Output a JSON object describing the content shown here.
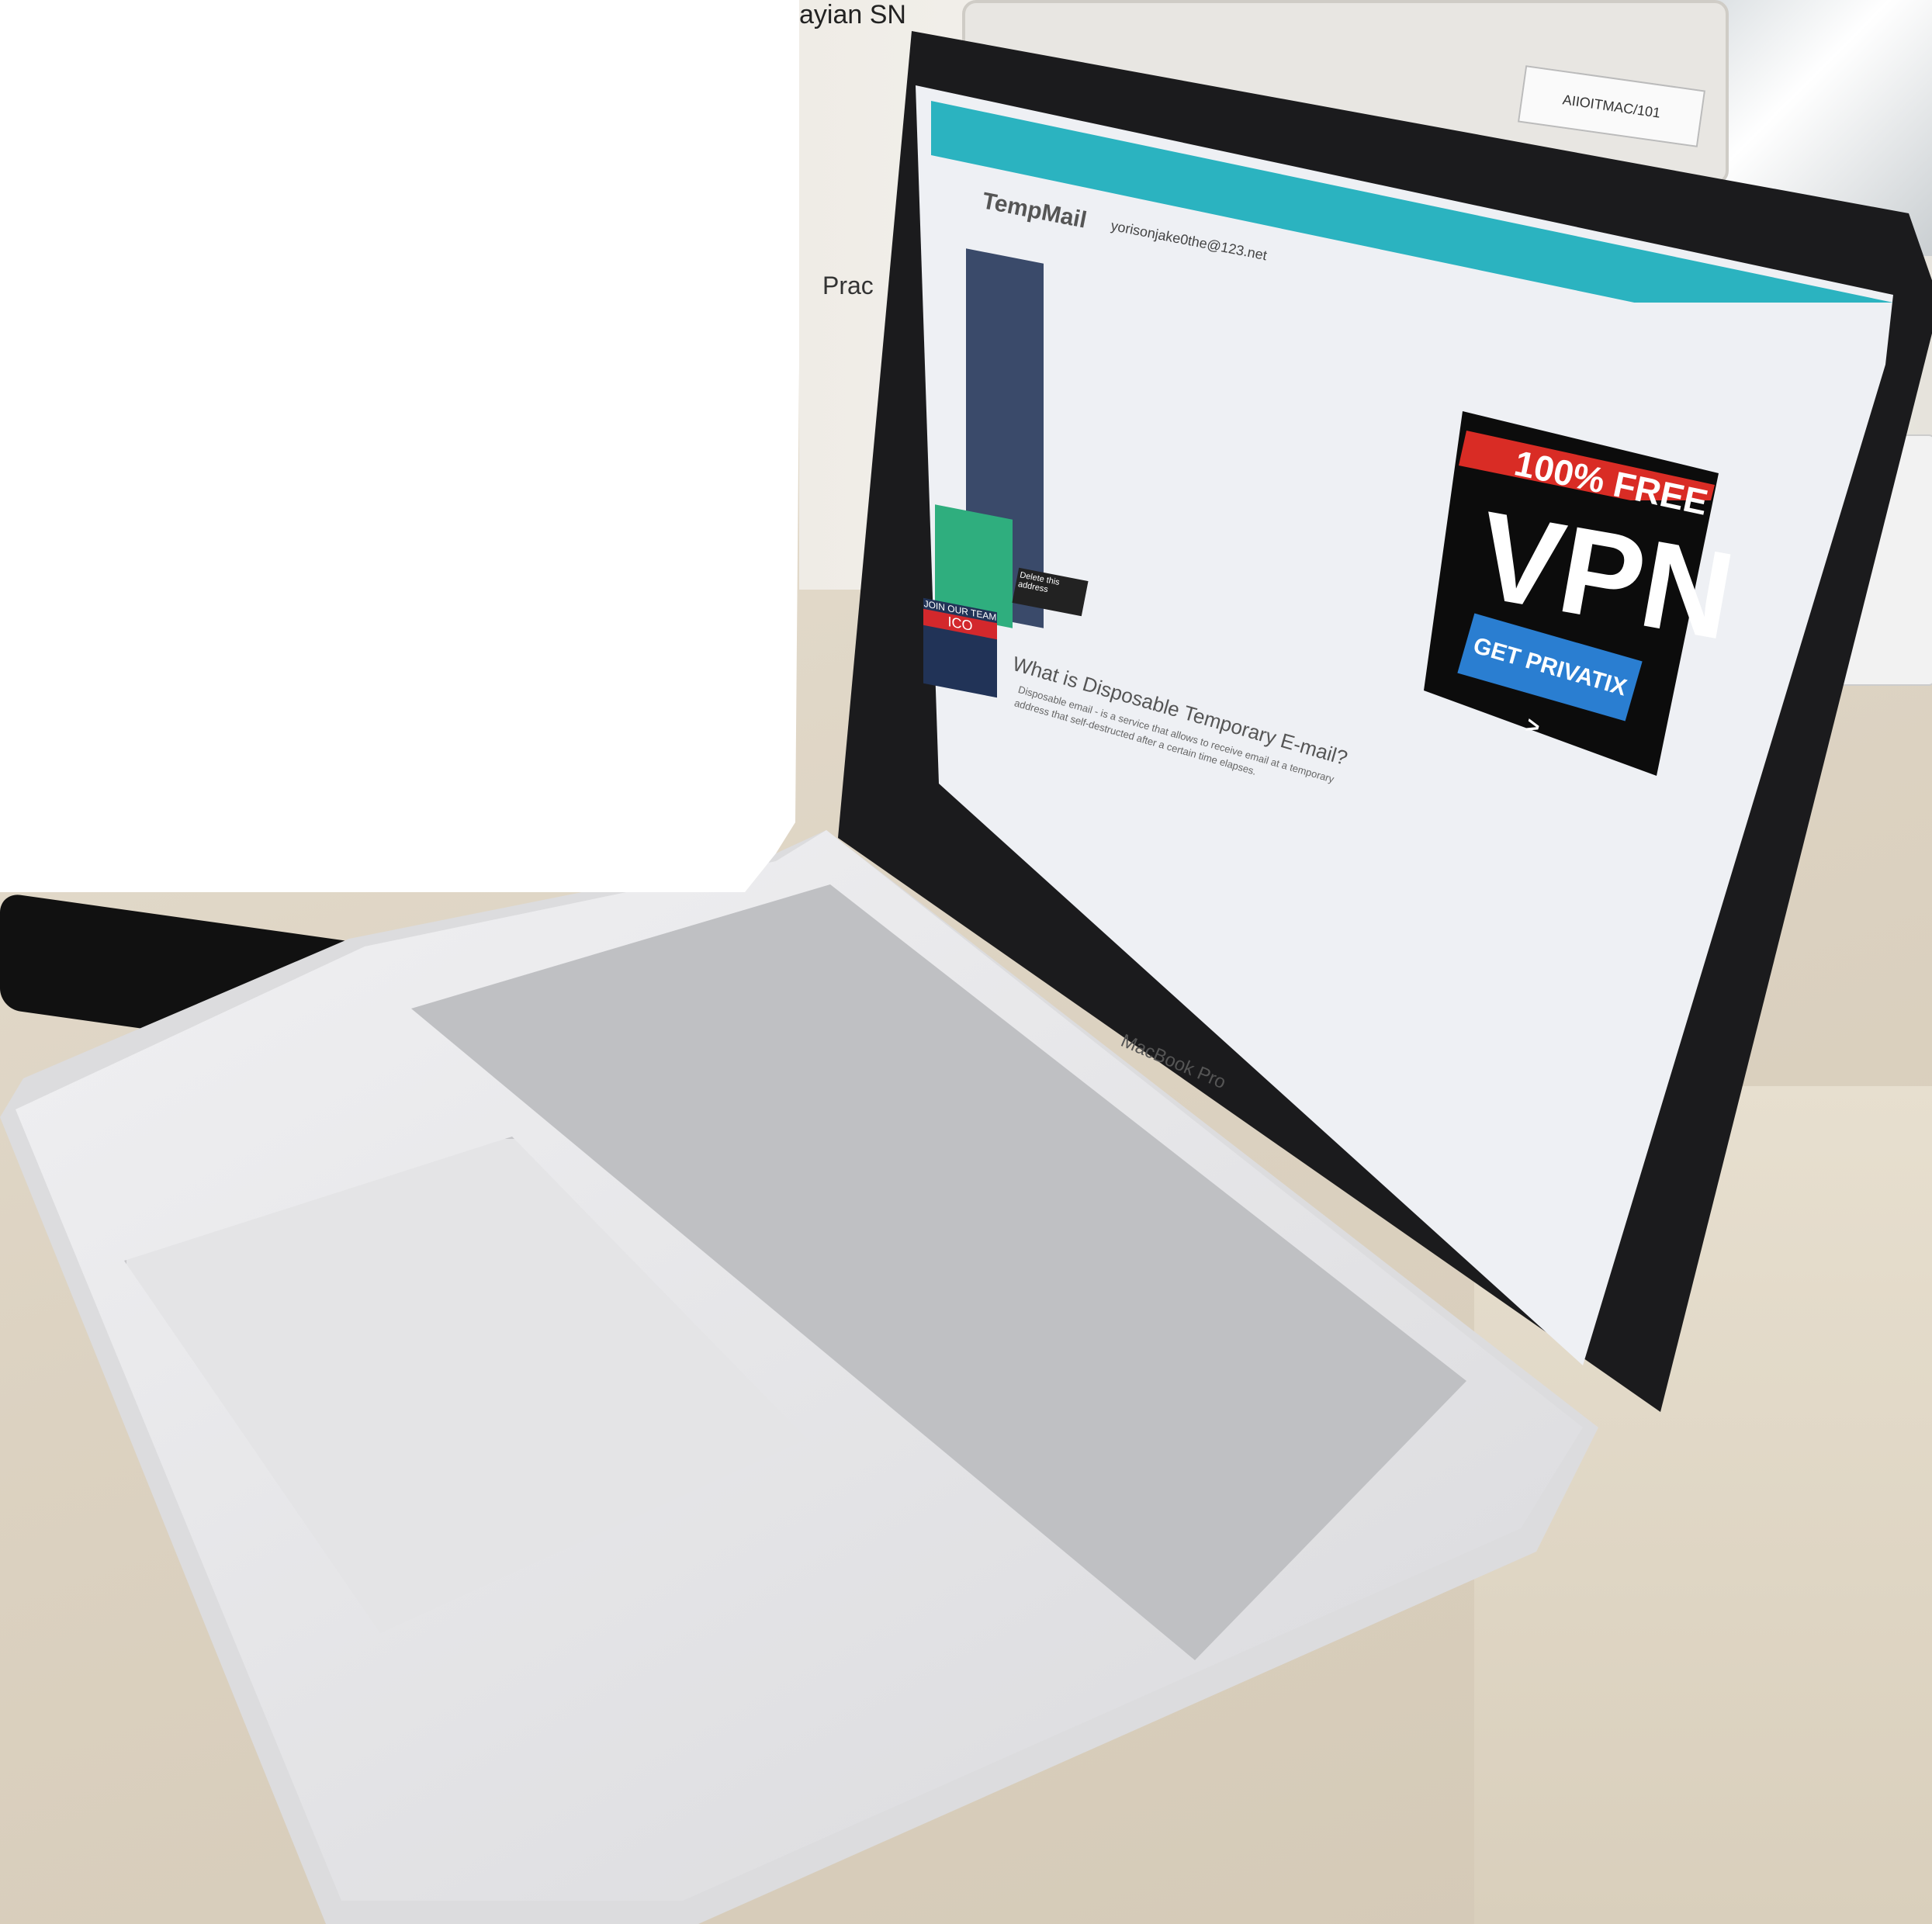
{
  "scene": {
    "desk_color": "#dcd2c1",
    "laptop_color": "#d9d9dc",
    "background_name_sign": "ayian SN",
    "background_sign": "Prac",
    "asset_tag": "AIIOITMAC/101"
  },
  "laptop": {
    "brand_text": "MacBook Pro"
  },
  "browser_page": {
    "site_logo": "TempMail",
    "email_address": "yorisonjake0the@123.net",
    "tooltip": "Delete this address",
    "heading": "What is Disposable Temporary E-mail?",
    "body_text": "Disposable email - is a service that allows to receive email at a temporary address that self-destructed after a certain time elapses.",
    "ico_ad": {
      "line1": "JOIN OUR TEAM",
      "line2": "ICO"
    },
    "vpn_ad": {
      "top": "100% FREE",
      "big": "VPN",
      "cta": "GET PRIVATIX >"
    }
  }
}
